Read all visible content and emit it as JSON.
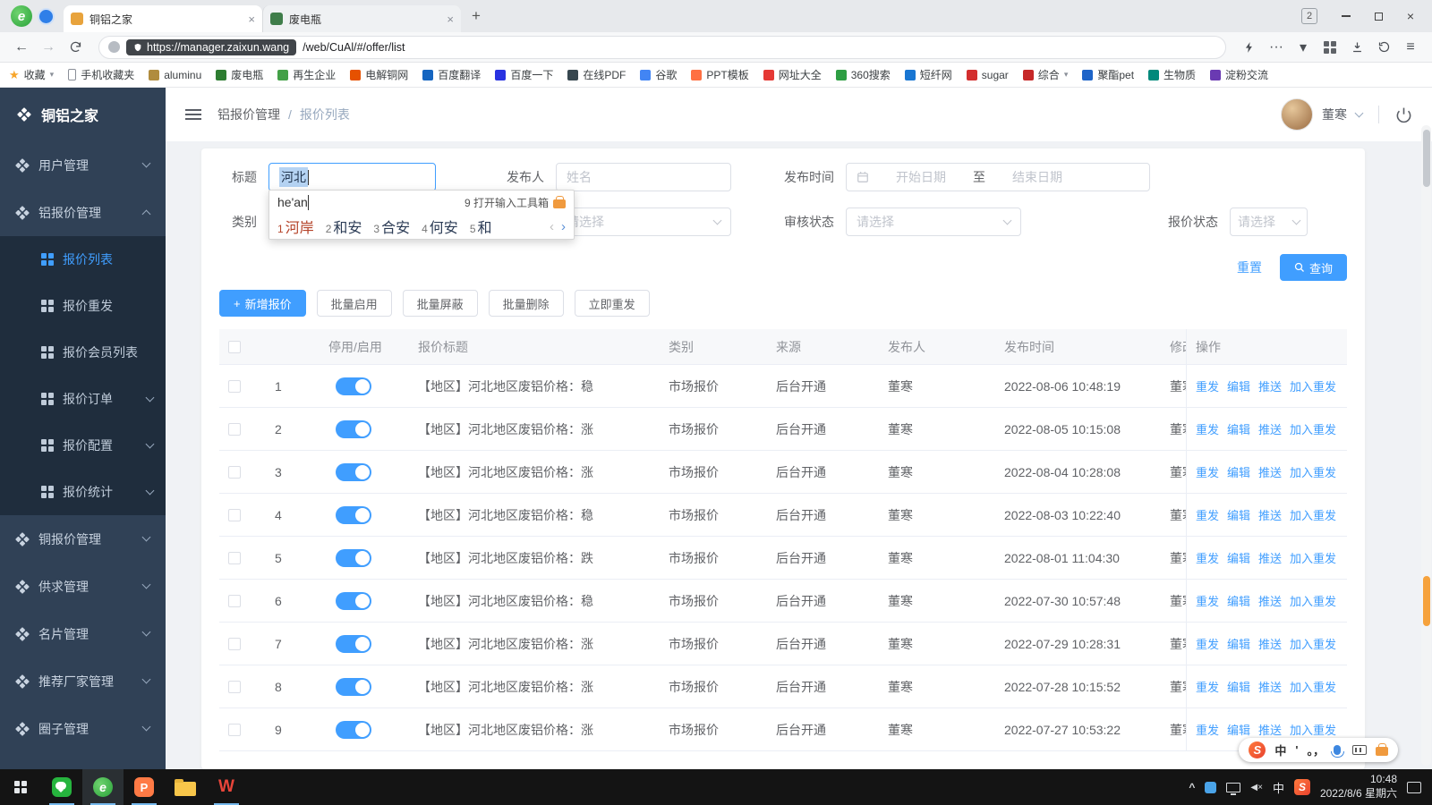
{
  "browser": {
    "tabs": [
      {
        "title": "铜铝之家",
        "favicon_color": "#e8a33c"
      },
      {
        "title": "废电瓶",
        "favicon_color": "#3f7d4a"
      }
    ],
    "tab_count_badge": "2",
    "url_origin": "https://manager.zaixun.wang",
    "url_path": "/web/CuAl/#/offer/list",
    "bookmarks": [
      {
        "label": "收藏",
        "icon": "star",
        "caret": true
      },
      {
        "label": "手机收藏夹",
        "icon": "phone"
      },
      {
        "label": "aluminu",
        "color": "#b08c3e"
      },
      {
        "label": "废电瓶",
        "color": "#2e7d32"
      },
      {
        "label": "再生企业",
        "color": "#43a047"
      },
      {
        "label": "电解铜网",
        "color": "#e65100"
      },
      {
        "label": "百度翻译",
        "color": "#1565c0"
      },
      {
        "label": "百度一下",
        "color": "#2932e1"
      },
      {
        "label": "在线PDF",
        "color": "#37474f"
      },
      {
        "label": "谷歌",
        "color": "#4285f4"
      },
      {
        "label": "PPT模板",
        "color": "#ff7043"
      },
      {
        "label": "网址大全",
        "color": "#e53935"
      },
      {
        "label": "360搜索",
        "color": "#2e9e43"
      },
      {
        "label": "短纤网",
        "color": "#1976d2"
      },
      {
        "label": "sugar",
        "color": "#d32f2f"
      },
      {
        "label": "综合",
        "color": "#c62828",
        "caret": true
      },
      {
        "label": "聚酯pet",
        "color": "#1e64c8"
      },
      {
        "label": "生物质",
        "color": "#00897b"
      },
      {
        "label": "淀粉交流",
        "color": "#6a3ab2"
      }
    ]
  },
  "sidebar": {
    "logo_text": "铜铝之家",
    "menu": [
      {
        "label": "用户管理",
        "caret": "down"
      },
      {
        "label": "铝报价管理",
        "caret": "up",
        "open": true,
        "children": [
          {
            "label": "报价列表",
            "active": true
          },
          {
            "label": "报价重发"
          },
          {
            "label": "报价会员列表"
          },
          {
            "label": "报价订单",
            "caret": "down"
          },
          {
            "label": "报价配置",
            "caret": "down"
          },
          {
            "label": "报价统计",
            "caret": "down"
          }
        ]
      },
      {
        "label": "铜报价管理",
        "caret": "down"
      },
      {
        "label": "供求管理",
        "caret": "down"
      },
      {
        "label": "名片管理",
        "caret": "down"
      },
      {
        "label": "推荐厂家管理",
        "caret": "down"
      },
      {
        "label": "圈子管理",
        "caret": "down"
      }
    ]
  },
  "header": {
    "breadcrumb": [
      "铝报价管理",
      "报价列表"
    ],
    "breadcrumb_separator": "/",
    "username": "董寒"
  },
  "filters": {
    "title_label": "标题",
    "title_value": "河北",
    "publisher_label": "发布人",
    "publisher_placeholder": "姓名",
    "date_label": "发布时间",
    "date_start_placeholder": "开始日期",
    "date_separator": "至",
    "date_end_placeholder": "结束日期",
    "category_label": "类别",
    "audit_label": "审核状态",
    "status_label": "报价状态",
    "select_placeholder": "请选择",
    "reset": "重置",
    "search": "查询"
  },
  "ime": {
    "composition": "he'an",
    "toolbox_hint": "9 打开输入工具箱",
    "candidates": [
      "河岸",
      "和安",
      "合安",
      "何安",
      "和"
    ]
  },
  "toolbar": {
    "add": "新增报价",
    "batch_enable": "批量启用",
    "batch_block": "批量屏蔽",
    "batch_delete": "批量删除",
    "resend_now": "立即重发"
  },
  "table": {
    "headers": {
      "toggle": "停用/启用",
      "title": "报价标题",
      "category": "类别",
      "source": "来源",
      "publisher": "发布人",
      "time": "发布时间",
      "modifier": "修改人",
      "actions": "操作"
    },
    "action_labels": [
      "重发",
      "编辑",
      "推送",
      "加入重发"
    ],
    "rows": [
      {
        "no": "1",
        "title": "【地区】河北地区废铝价格：稳",
        "category": "市场报价",
        "source": "后台开通",
        "publisher": "董寒",
        "time": "2022-08-06 10:48:19",
        "modifier": "董寒",
        "enabled": true
      },
      {
        "no": "2",
        "title": "【地区】河北地区废铝价格：涨",
        "category": "市场报价",
        "source": "后台开通",
        "publisher": "董寒",
        "time": "2022-08-05 10:15:08",
        "modifier": "董寒",
        "enabled": true
      },
      {
        "no": "3",
        "title": "【地区】河北地区废铝价格：涨",
        "category": "市场报价",
        "source": "后台开通",
        "publisher": "董寒",
        "time": "2022-08-04 10:28:08",
        "modifier": "董寒",
        "enabled": true
      },
      {
        "no": "4",
        "title": "【地区】河北地区废铝价格：稳",
        "category": "市场报价",
        "source": "后台开通",
        "publisher": "董寒",
        "time": "2022-08-03 10:22:40",
        "modifier": "董寒",
        "enabled": true
      },
      {
        "no": "5",
        "title": "【地区】河北地区废铝价格：跌",
        "category": "市场报价",
        "source": "后台开通",
        "publisher": "董寒",
        "time": "2022-08-01 11:04:30",
        "modifier": "董寒",
        "enabled": true
      },
      {
        "no": "6",
        "title": "【地区】河北地区废铝价格：稳",
        "category": "市场报价",
        "source": "后台开通",
        "publisher": "董寒",
        "time": "2022-07-30 10:57:48",
        "modifier": "董寒",
        "enabled": true
      },
      {
        "no": "7",
        "title": "【地区】河北地区废铝价格：涨",
        "category": "市场报价",
        "source": "后台开通",
        "publisher": "董寒",
        "time": "2022-07-29 10:28:31",
        "modifier": "董寒",
        "enabled": true
      },
      {
        "no": "8",
        "title": "【地区】河北地区废铝价格：涨",
        "category": "市场报价",
        "source": "后台开通",
        "publisher": "董寒",
        "time": "2022-07-28 10:15:52",
        "modifier": "董寒",
        "enabled": true
      },
      {
        "no": "9",
        "title": "【地区】河北地区废铝价格：涨",
        "category": "市场报价",
        "source": "后台开通",
        "publisher": "董寒",
        "time": "2022-07-27 10:53:22",
        "modifier": "董寒",
        "enabled": true
      }
    ]
  },
  "taskbar": {
    "time": "10:48",
    "date": "2022/8/6 星期六",
    "ime_lang": "中"
  },
  "sogou_bar": {
    "lang": "中",
    "punct": "。，",
    "apostrophe": "'"
  },
  "colors": {
    "primary": "#409EFF",
    "sidebar_bg": "#304156",
    "submenu_bg": "#1f2d3d",
    "toggle_on": "#409EFF"
  }
}
